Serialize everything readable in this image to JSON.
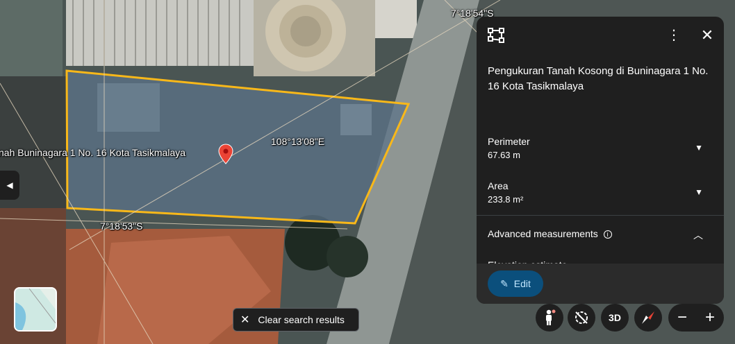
{
  "map": {
    "place_label": "nah Buninagara 1 No. 16 Kota Tasikmalaya",
    "lng_label": "108°13'08\"E",
    "lat_label_bottom": "7°18'53\"S",
    "lat_label_top": "7°18'54\"S",
    "clear_search_label": "Clear search results",
    "threed_label": "3D",
    "zoom_out_label": "−",
    "zoom_in_label": "+",
    "collapse_glyph": "◀",
    "colors": {
      "polygon_stroke": "#f9b819",
      "pin": "#ea4335"
    }
  },
  "panel": {
    "title": "Pengukuran Tanah Kosong di Buninagara 1 No. 16 Kota Tasikmalaya",
    "more_glyph": "⋮",
    "close_glyph": "✕",
    "perimeter": {
      "label": "Perimeter",
      "value": "67.63 m"
    },
    "area": {
      "label": "Area",
      "value": "233.8 m²"
    },
    "advanced": {
      "label": "Advanced measurements",
      "info_glyph": "i"
    },
    "elevation_label": "Elevation estimate",
    "edit_label": "Edit",
    "icons": [
      "measure-polygon-icon",
      "more-vert-icon",
      "close-icon",
      "chevron-down-icon",
      "chevron-up-icon",
      "info-icon",
      "pencil-icon"
    ]
  }
}
